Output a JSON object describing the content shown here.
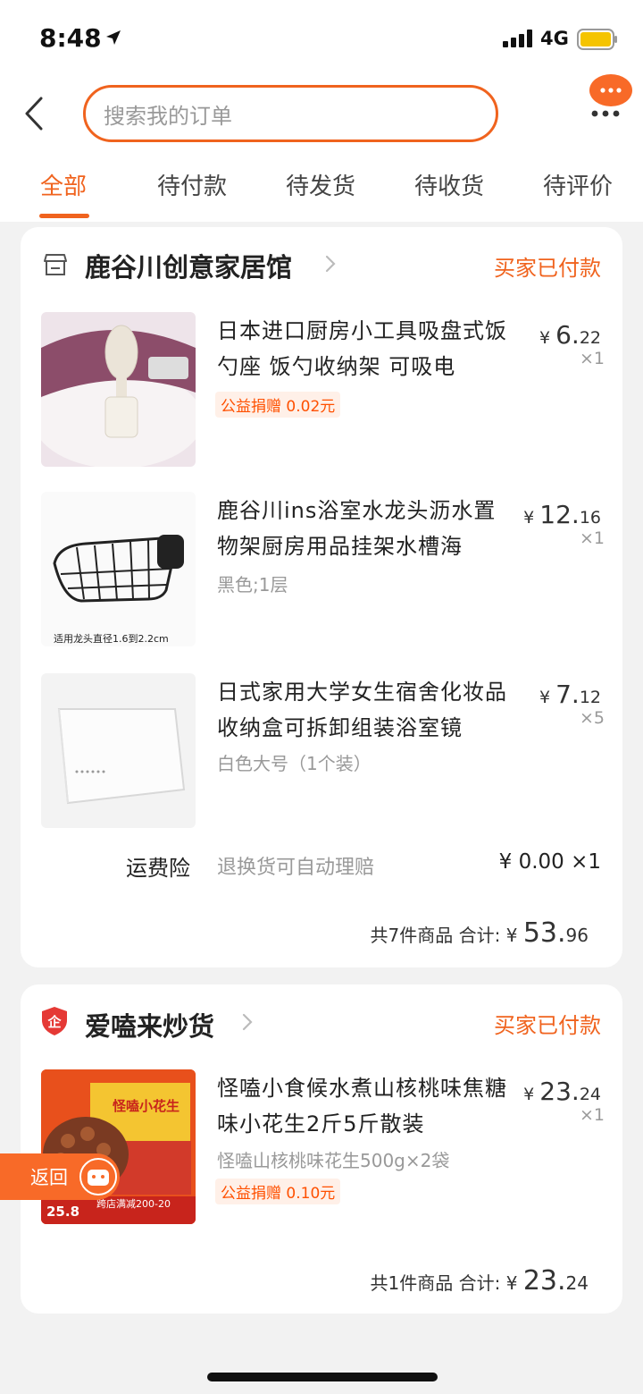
{
  "status_bar": {
    "time": "8:48",
    "network": "4G",
    "battery_color": "#f5c400"
  },
  "header": {
    "search_placeholder": "搜索我的订单",
    "accent_color": "#f0631e"
  },
  "tabs": [
    {
      "label": "全部",
      "active": true
    },
    {
      "label": "待付款",
      "active": false
    },
    {
      "label": "待发货",
      "active": false
    },
    {
      "label": "待收货",
      "active": false
    },
    {
      "label": "待评价",
      "active": false
    }
  ],
  "orders": [
    {
      "shop_name": "鹿谷川创意家居馆",
      "shop_icon": "store-icon",
      "status": "买家已付款",
      "items": [
        {
          "title": "日本进口厨房小工具吸盘式饭勺座 饭勺收纳架 可吸电",
          "tag": "公益捐赠 0.02元",
          "currency": "¥",
          "price_int": "6.",
          "price_dec": "22",
          "qty": "×1"
        },
        {
          "title": "鹿谷川ins浴室水龙头沥水置物架厨房用品挂架水槽海",
          "sku": "黑色;1层",
          "thumb_caption": "适用龙头直径1.6到2.2cm",
          "currency": "¥",
          "price_int": "12.",
          "price_dec": "16",
          "qty": "×1"
        },
        {
          "title": "日式家用大学女生宿舍化妆品收纳盒可拆卸组装浴室镜",
          "sku": "白色大号（1个装）",
          "currency": "¥",
          "price_int": "7.",
          "price_dec": "12",
          "qty": "×5"
        }
      ],
      "insurance": {
        "label": "运费险",
        "desc": "退换货可自动理赔",
        "price": "¥ 0.00 ×1"
      },
      "summary": {
        "count_text": "共7件商品",
        "total_label": "合计:",
        "currency": "¥",
        "total_int": "53.",
        "total_dec": "96"
      }
    },
    {
      "shop_name": "爱嗑来炒货",
      "shop_icon": "enterprise-badge-icon",
      "status": "买家已付款",
      "items": [
        {
          "title": "怪嗑小食候水煮山核桃味焦糖味小花生2斤5斤散装",
          "sku": "怪嗑山核桃味花生500g×2袋",
          "tag": "公益捐赠 0.10元",
          "thumb_texts": [
            "怪嗑小花生",
            "25.8",
            "跨店满减200-20"
          ],
          "currency": "¥",
          "price_int": "23.",
          "price_dec": "24",
          "qty": "×1"
        }
      ],
      "summary": {
        "count_text": "共1件商品",
        "total_label": "合计:",
        "currency": "¥",
        "total_int": "23.",
        "total_dec": "24"
      }
    }
  ],
  "float_button": {
    "label": "返回"
  }
}
